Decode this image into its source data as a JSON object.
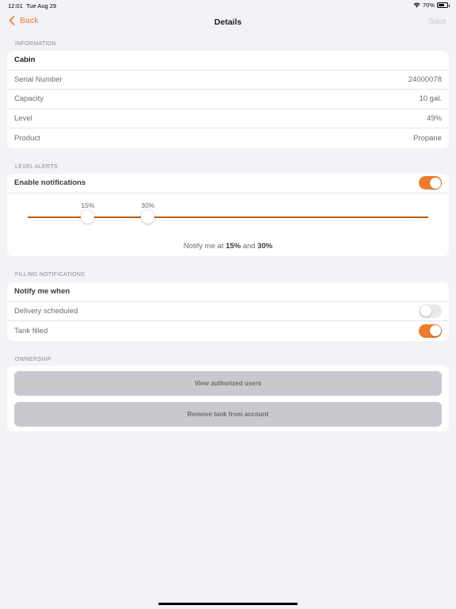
{
  "status_bar": {
    "time": "12:01",
    "date": "Tue Aug 29",
    "battery": "70%",
    "battery_level": 0.7
  },
  "nav": {
    "back_label": "Back",
    "title": "Details",
    "save_label": "Save"
  },
  "information": {
    "header": "INFORMATION",
    "name": "Cabin",
    "rows": [
      {
        "label": "Serial Number",
        "value": "24000078"
      },
      {
        "label": "Capacity",
        "value": "10 gal."
      },
      {
        "label": "Level",
        "value": "49%"
      },
      {
        "label": "Product",
        "value": "Propane"
      }
    ]
  },
  "level_alerts": {
    "header": "LEVEL ALERTS",
    "enable_label": "Enable notifications",
    "enabled": true,
    "low_label": "15%",
    "high_label": "30%",
    "low_value": 15,
    "high_value": 30,
    "notify_prefix": "Notify me at",
    "notify_low": "15%",
    "notify_and": "and",
    "notify_high": "30%"
  },
  "filling": {
    "header": "FILLING NOTIFICATIONS",
    "title": "Notify me when",
    "delivery_label": "Delivery scheduled",
    "delivery_on": false,
    "tank_filled_label": "Tank filled",
    "tank_filled_on": true
  },
  "ownership": {
    "header": "OWNERSHIP",
    "view_users_label": "View authorized users",
    "remove_label": "Remove tank from account"
  },
  "colors": {
    "accent": "#ee7b2b",
    "track": "#c45e10",
    "background": "#f2f2f7"
  }
}
